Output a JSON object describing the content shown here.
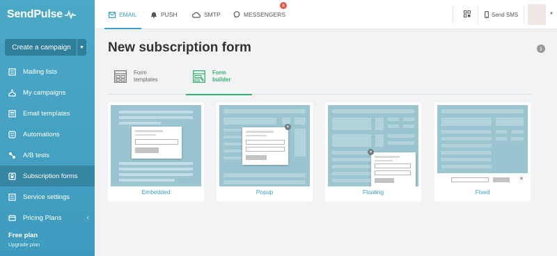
{
  "app": {
    "logo_text": "SendPulse"
  },
  "sidebar": {
    "create_label": "Create a campaign",
    "items": [
      {
        "label": "Mailing lists",
        "icon": "list-icon"
      },
      {
        "label": "My campaigns",
        "icon": "campaigns-icon"
      },
      {
        "label": "Email templates",
        "icon": "template-icon"
      },
      {
        "label": "Automations",
        "icon": "automation-icon"
      },
      {
        "label": "A/B tests",
        "icon": "ab-test-icon"
      },
      {
        "label": "Subscription forms",
        "icon": "form-icon",
        "active": true
      },
      {
        "label": "Service settings",
        "icon": "settings-icon"
      },
      {
        "label": "Pricing Plans",
        "icon": "pricing-icon"
      }
    ],
    "plan_title": "Free plan",
    "plan_link": "Upgrade plan"
  },
  "topbar": {
    "tabs": [
      {
        "label": "EMAIL",
        "icon": "email-icon",
        "active": true
      },
      {
        "label": "PUSH",
        "icon": "bell-icon"
      },
      {
        "label": "SMTP",
        "icon": "cloud-icon"
      },
      {
        "label": "MESSENGERS",
        "icon": "chat-icon",
        "badge": "8"
      }
    ],
    "send_sms_label": "Send SMS"
  },
  "page": {
    "title": "New subscription form",
    "subtabs": [
      {
        "line1": "Form",
        "line2": "templates",
        "icon": "grid-icon"
      },
      {
        "line1": "Form",
        "line2": "builder",
        "icon": "builder-icon",
        "active": true
      }
    ]
  },
  "cards": [
    {
      "label": "Embedded"
    },
    {
      "label": "Popup"
    },
    {
      "label": "Floating"
    },
    {
      "label": "Fixed"
    }
  ],
  "colors": {
    "sidebar": "#4ba8c7",
    "accent": "#3aa0c8",
    "active_green": "#33b26d",
    "badge": "#e2574c"
  }
}
